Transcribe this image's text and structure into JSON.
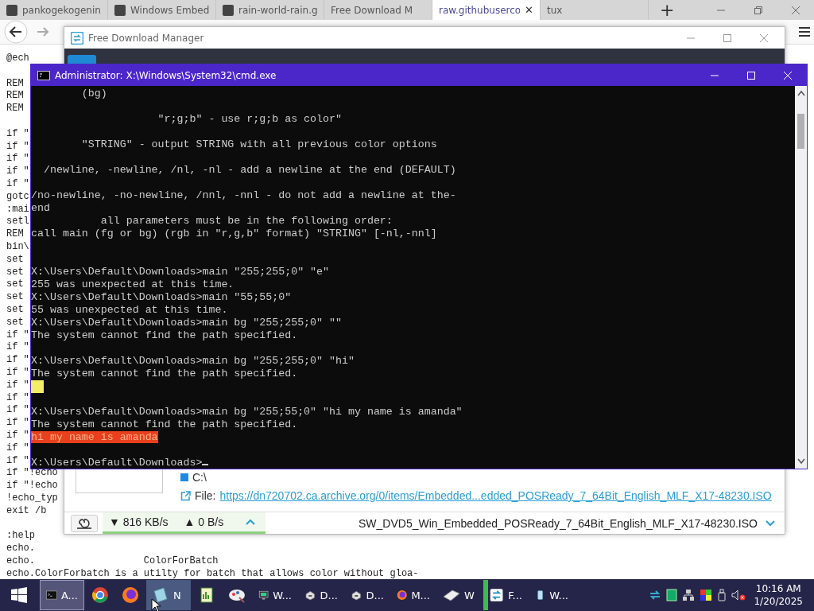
{
  "browser": {
    "tabs": [
      {
        "label": "pankogekogenin",
        "selected": false
      },
      {
        "label": "Windows Embed",
        "selected": false
      },
      {
        "label": "rain-world-rain.g",
        "selected": false
      },
      {
        "label": "Free Download M",
        "selected": false
      },
      {
        "label": "raw.githubuserco",
        "selected": true
      },
      {
        "label": "tux",
        "selected": false
      }
    ],
    "new_tab": "+",
    "close_tab": "✕",
    "blocks": [
      [
        "@ech"
      ],
      [
        "REM",
        "REM",
        "REM"
      ],
      [
        "if \"",
        "if \"",
        "if \"",
        "if \"",
        "if \"",
        "gotc",
        ":mai",
        "setl",
        "REM",
        "bin\\",
        "set",
        "set",
        "set",
        "set",
        "set",
        "set",
        "if \"",
        "if \"",
        "if \"",
        "if \"",
        "if \"",
        "if \"",
        "if \"",
        "if \"",
        "if \"",
        "if \"",
        "if \"",
        "if \"!echo",
        "if \"!echo",
        "!echo_typ",
        "exit /b"
      ],
      [
        ":help",
        "echo.",
        "echo.                   ColorForBatch",
        "echo.ColorForbatch is a utilty for batch that allows color without gloa-"
      ]
    ]
  },
  "fdm": {
    "title": "Free Download Manager",
    "folder": "C:\\",
    "file_label": "File:",
    "file_url": "https://dn720702.ca.archive.org/0/items/Embedded...edded_POSReady_7_64Bit_English_MLF_X17-48230.ISO",
    "download_speed": "▼ 816 KB/s",
    "upload_speed": "▲ 0 B/s",
    "file_name": "SW_DVD5_Win_Embedded_POSReady_7_64Bit_English_MLF_X17-48230.ISO"
  },
  "cmd": {
    "title": "Administrator: X:\\Windows\\System32\\cmd.exe",
    "lines": [
      {
        "text": "        (bg)"
      },
      {
        "kind": "blank"
      },
      {
        "text": "                    \"r;g;b\" - use r;g;b as color\""
      },
      {
        "kind": "blank"
      },
      {
        "text": "        \"STRING\" - output STRING with all previous color options"
      },
      {
        "kind": "blank"
      },
      {
        "text": "  /newline, -newline, /nl, -nl - add a newline at the end (DEFAULT)"
      },
      {
        "kind": "blank"
      },
      {
        "text": "/no-newline, -no-newline, /nnl, -nnl - do not add a newline at the-"
      },
      {
        "text": "end"
      },
      {
        "text": "           all parameters must be in the following order:"
      },
      {
        "text": "call main (fg or bg) (rgb in \"r,g,b\" format) \"STRING\" [-nl,-nnl]"
      },
      {
        "kind": "blank"
      },
      {
        "kind": "blank"
      },
      {
        "text": "X:\\Users\\Default\\Downloads>main \"255;255;0\" \"e\""
      },
      {
        "text": "255 was unexpected at this time."
      },
      {
        "text": "X:\\Users\\Default\\Downloads>main \"55;55;0\""
      },
      {
        "text": "55 was unexpected at this time."
      },
      {
        "text": "X:\\Users\\Default\\Downloads>main bg \"255;255;0\" \"\""
      },
      {
        "text": "The system cannot find the path specified."
      },
      {
        "kind": "blank"
      },
      {
        "text": "X:\\Users\\Default\\Downloads>main bg \"255;255;0\" \"hi\""
      },
      {
        "text": "The system cannot find the path specified."
      },
      {
        "kind": "swatch",
        "color": "#f2ee6a"
      },
      {
        "kind": "blank"
      },
      {
        "text": "X:\\Users\\Default\\Downloads>main bg \"255;55;0\" \"hi my name is amanda\""
      },
      {
        "text": "The system cannot find the path specified."
      },
      {
        "kind": "highlight",
        "text": "hi my name is amanda",
        "color": "#e8401c"
      },
      {
        "kind": "blank"
      },
      {
        "kind": "prompt",
        "text": "X:\\Users\\Default\\Downloads>"
      }
    ]
  },
  "taskbar": {
    "items": [
      {
        "label": "A...",
        "selected": true,
        "hovered": false
      },
      {
        "selected": false,
        "hovered": false
      },
      {
        "selected": false,
        "hovered": false
      },
      {
        "label": "N",
        "selected": false,
        "hovered": true
      },
      {
        "selected": false,
        "hovered": false
      },
      {
        "selected": false,
        "hovered": false
      },
      {
        "label": "W...",
        "selected": false,
        "hovered": false
      },
      {
        "label": "D...",
        "selected": false,
        "hovered": false
      },
      {
        "label": "D...",
        "selected": false,
        "hovered": false
      },
      {
        "label": "M...",
        "selected": false,
        "hovered": false
      },
      {
        "label": "W",
        "selected": false,
        "hovered": false
      },
      {
        "label": "F...",
        "selected": false,
        "hovered": false,
        "color": "#3cbf4a"
      },
      {
        "label": "W...",
        "selected": false,
        "hovered": false
      }
    ],
    "time": "10:16 AM",
    "date": "1/20/2025"
  }
}
